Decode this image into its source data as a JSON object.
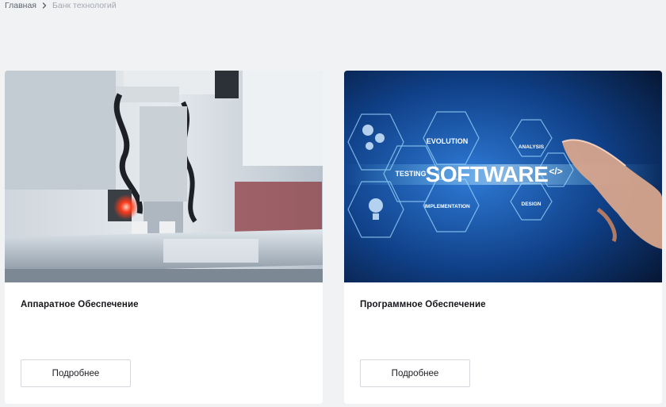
{
  "breadcrumb": {
    "home": "Главная",
    "current": "Банк технологий"
  },
  "cards": [
    {
      "title": "Аппаратное Обеспечение",
      "button_label": "Подробнее",
      "image": "industrial-robot-gripper-photo"
    },
    {
      "title": "Программное Обеспечение",
      "button_label": "Подробнее",
      "image": "software-hexagon-concept-photo",
      "image_text": {
        "main": "SOFTWARE",
        "evolution": "EVOLUTION",
        "analysis": "ANALYSIS",
        "testing": "TESTING",
        "implementation": "IMPLEMENTATION",
        "design": "DESIGN",
        "code_symbol": "</>"
      }
    }
  ],
  "colors": {
    "page_bg": "#f1f2f4",
    "card_bg": "#ffffff",
    "button_border": "#d5d8dd"
  }
}
